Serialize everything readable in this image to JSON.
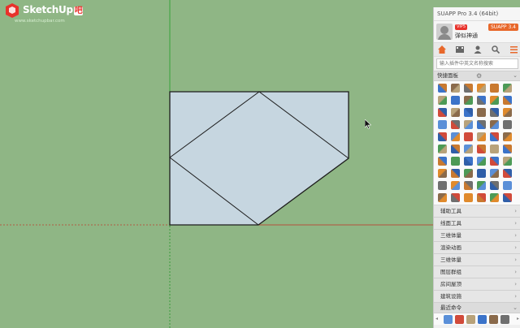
{
  "logo": {
    "name": "SketchUp",
    "badge": "吧",
    "url": "www.sketchupbar.com"
  },
  "panel": {
    "title": "SUAPP Pro 3.4 (64bit)",
    "vip": "VIP5",
    "username": "弹似神通",
    "version_badge": "SUAPP 3.4",
    "search_placeholder": "输入插件中英文名称搜索",
    "quick_panel_label": "快捷面板",
    "menu_items": [
      "辅助工具",
      "线面工具",
      "三维体量",
      "渲染动画",
      "三维体量",
      "图层群组",
      "房间屋顶",
      "建筑设施"
    ],
    "recent_label": "最近命令"
  },
  "icons": {
    "logo": "sketchup-cube-icon",
    "avatar": "cat-avatar-icon",
    "nav": [
      "home-icon",
      "film-icon",
      "user-icon",
      "search-icon",
      "menu-icon"
    ],
    "gear": "gear-icon",
    "chevron": "chevron-right-icon",
    "cursor": "mouse-cursor-icon"
  },
  "colors": {
    "canvas_bg": "#8fb685",
    "face_fill": "#c6d6e0",
    "edge": "#1d1d1d",
    "axis_green": "#37a33b",
    "axis_red": "#b5533c",
    "accent_orange": "#e8682b"
  }
}
